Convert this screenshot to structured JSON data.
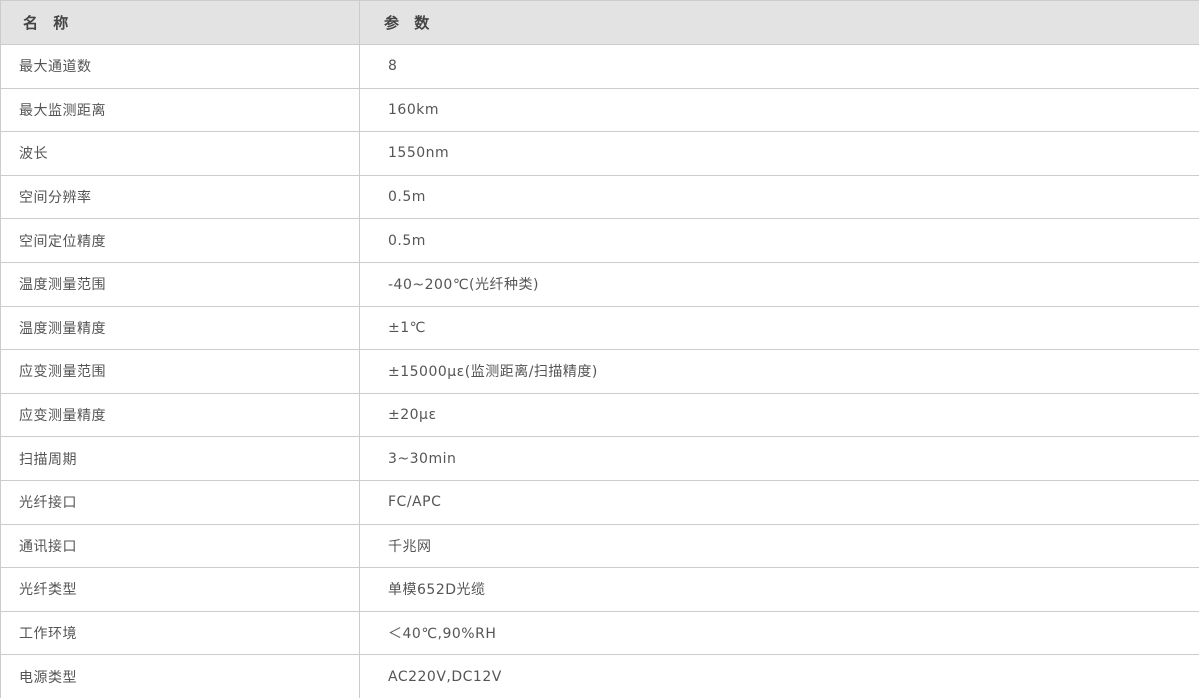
{
  "table": {
    "headers": [
      "名 称",
      "参 数"
    ],
    "rows": [
      [
        "最大通道数",
        "8"
      ],
      [
        "最大监测距离",
        "160km"
      ],
      [
        "波长",
        "1550nm"
      ],
      [
        "空间分辨率",
        "0.5m"
      ],
      [
        "空间定位精度",
        "0.5m"
      ],
      [
        "温度测量范围",
        "-40~200℃(光纤种类)"
      ],
      [
        "温度测量精度",
        "±1℃"
      ],
      [
        "应变测量范围",
        "±15000με(监测距离/扫描精度)"
      ],
      [
        "应变测量精度",
        "±20με"
      ],
      [
        "扫描周期",
        "3~30min"
      ],
      [
        "光纤接口",
        "FC/APC"
      ],
      [
        "通讯接口",
        "千兆网"
      ],
      [
        "光纤类型",
        "单模652D光缆"
      ],
      [
        "工作环境",
        "＜40℃,90%RH"
      ],
      [
        "电源类型",
        "AC220V,DC12V"
      ]
    ]
  },
  "colors": {
    "header_bg": "#e3e3e3",
    "border": "#cccccc",
    "text": "#555555"
  }
}
